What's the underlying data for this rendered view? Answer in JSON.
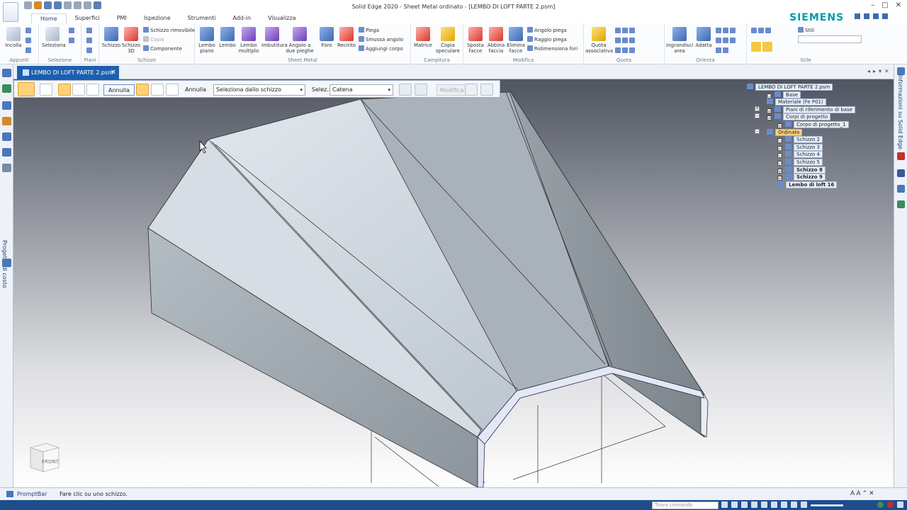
{
  "app": {
    "title": "Solid Edge 2020 - Sheet Metal ordinato - [LEMBO DI LOFT PARTE 2.psm]",
    "brand": "SIEMENS",
    "window_controls": [
      "–",
      "□",
      "✕"
    ]
  },
  "ribbon_tabs": [
    "Home",
    "Superfici",
    "PMI",
    "Ispezione",
    "Strumenti",
    "Add-in",
    "Visualizza"
  ],
  "ribbon": {
    "appunti": {
      "label": "Appunti",
      "incolla": "Incolla"
    },
    "selezione": {
      "label": "Selezione",
      "seleziona": "Seleziona"
    },
    "piani": {
      "label": "Piani"
    },
    "schizzo": {
      "label": "Schizzo",
      "schizzo": "Schizzo",
      "schizzo3d": "Schizzo 3D",
      "rimovibile": "Schizzo rimovibile",
      "copia": "Copia",
      "componente": "Componente"
    },
    "sheet_metal": {
      "label": "Sheet Metal",
      "lembo_piano": "Lembo piano",
      "lembo": "Lembo",
      "lembo_multiplo": "Lembo multiplo",
      "imbutitura": "Imbutitura",
      "angolo": "Angolo a due pieghe",
      "foro": "Foro",
      "recinto": "Recinto",
      "piega": "Piega",
      "smussa": "Smussa angolo",
      "aggiungi": "Aggiungi corpo"
    },
    "campitura": {
      "label": "Campitura",
      "matrice": "Matrice",
      "copia_speculare": "Copia speculare"
    },
    "modifica": {
      "label": "Modifica",
      "sposta": "Sposta facce",
      "abbina": "Abbina faccia",
      "elimina": "Elimina facce",
      "angolo_piega": "Angolo piega",
      "raggio_piega": "Raggio piega",
      "ridim_fori": "Ridimensiona fori"
    },
    "quota": {
      "label": "Quota",
      "quota_assoc": "Quota associativa"
    },
    "orienta": {
      "label": "Orienta",
      "ingrandisci": "Ingrandisci area",
      "adatta": "Adatta"
    },
    "stile": {
      "label": "Stile",
      "stili": "Stili"
    }
  },
  "document_tab": {
    "name": "LEMBO DI LOFT PARTE 2.psm"
  },
  "command_bar": {
    "annulla1": "Annulla",
    "annulla2": "Annulla",
    "source_select": "Seleziona dallo schizzo",
    "selez_label": "Selez.:",
    "selez_value": "Catena",
    "modifica": "Modifica"
  },
  "left_panel_vertical": "Progetto di costo",
  "right_panel_vertical": "Informazioni su Solid Edge",
  "pathfinder": [
    {
      "label": "LEMBO DI LOFT PARTE 2.psm",
      "level": 0,
      "check": "",
      "exp": ""
    },
    {
      "label": "Base",
      "level": 1,
      "check": "☐",
      "exp": ""
    },
    {
      "label": "Materiale (Fe P01)",
      "level": 1,
      "check": "",
      "exp": ""
    },
    {
      "label": "Piani di riferimento di base",
      "level": 1,
      "check": "☑",
      "exp": "+"
    },
    {
      "label": "Corpi di progetto",
      "level": 1,
      "check": "☑",
      "exp": "−"
    },
    {
      "label": "Corpo di progetto_1",
      "level": 2,
      "check": "☑",
      "exp": ""
    },
    {
      "label": "Ordinato",
      "level": 1,
      "check": "",
      "exp": "−",
      "selected": true
    },
    {
      "label": "Schizzo 2",
      "level": 2,
      "check": "☐",
      "exp": ""
    },
    {
      "label": "Schizzo 3",
      "level": 2,
      "check": "☐",
      "exp": ""
    },
    {
      "label": "Schizzo 4",
      "level": 2,
      "check": "☐",
      "exp": ""
    },
    {
      "label": "Schizzo 5",
      "level": 2,
      "check": "☐",
      "exp": ""
    },
    {
      "label": "Schizzo 8",
      "level": 2,
      "check": "☑",
      "exp": "",
      "bold": true
    },
    {
      "label": "Schizzo 9",
      "level": 2,
      "check": "☑",
      "exp": "",
      "bold": true
    },
    {
      "label": "Lembo di loft 16",
      "level": 2,
      "check": "",
      "exp": "",
      "bold": true
    }
  ],
  "view_cube": {
    "face": "FRONT"
  },
  "status": {
    "prompt_label": "PromptBar",
    "prompt_text": "Fare clic su uno schizzo.",
    "search_placeholder": "Trova comando"
  },
  "colors": {
    "accent": "#1d5fae",
    "siemens": "#0099a8",
    "highlight": "#fcd27a"
  }
}
